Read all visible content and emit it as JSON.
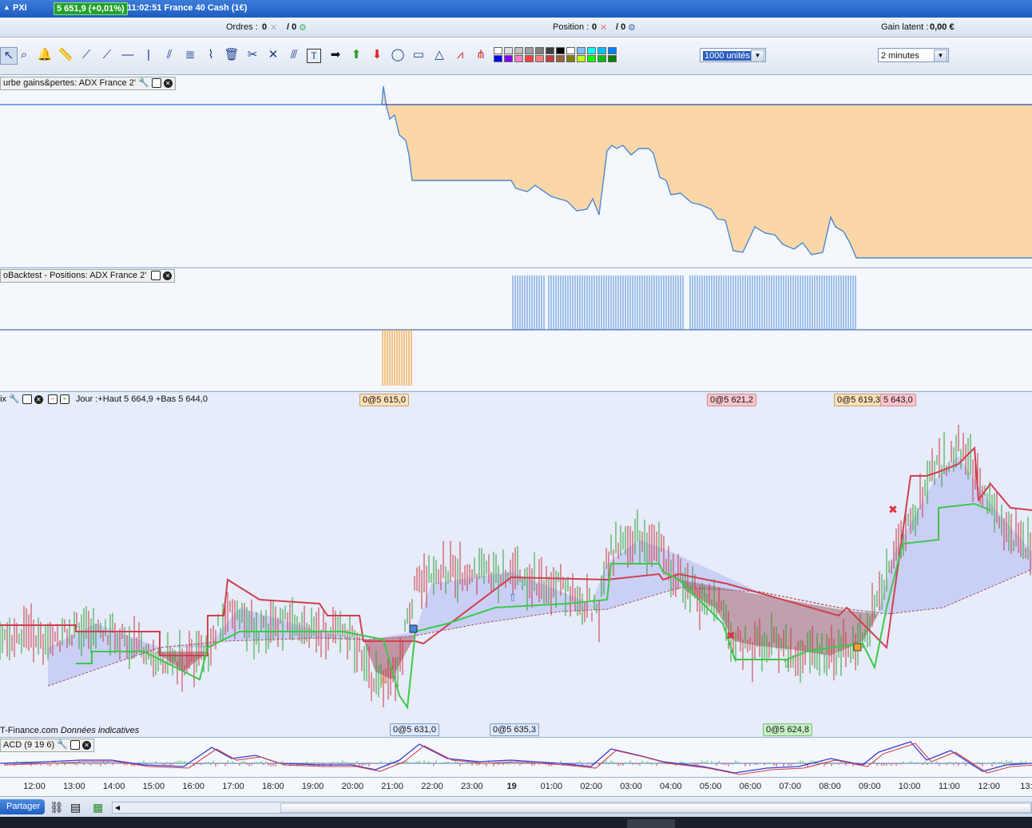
{
  "topbar": {
    "symbol": "PXI",
    "price_change": "5 651,9 (+0,01%)",
    "time_instrument": "11:02:51 France 40 Cash (1€)"
  },
  "orderbar": {
    "orders_label": "Ordres :",
    "orders_val1": "0",
    "orders_val2": "/ 0",
    "position_label": "Position :",
    "position_val1": "0",
    "position_val2": "/ 0",
    "gain_label": "Gain latent :",
    "gain_value": "0,00 €"
  },
  "toolbar": {
    "size_select": "1000 unités",
    "timeframe_select": "2 minutes"
  },
  "panels": {
    "equity_title": "urbe gains&pertes: ADX France 2'",
    "positions_title": "oBacktest - Positions: ADX France 2'",
    "price_title": "ix",
    "price_info": "Jour :+Haut 5 664,9 +Bas 5 644,0",
    "source": "T-Finance.com",
    "source_note": "Données indicatives",
    "macd_title": "ACD (9 19 6)"
  },
  "flags": {
    "f1": "0@5 615,0",
    "f2": "0@5 621,2",
    "f3": "0@5 619,3",
    "f4": "5 643,0",
    "f5": "0@5 631,0",
    "f6": "0@5 635,3",
    "f7": "0@5 624,8"
  },
  "time_axis": [
    "12:00",
    "13:00",
    "14:00",
    "15:00",
    "16:00",
    "17:00",
    "18:00",
    "19:00",
    "20:00",
    "21:00",
    "22:00",
    "23:00",
    "19",
    "01:00",
    "02:00",
    "03:00",
    "04:00",
    "05:00",
    "06:00",
    "07:00",
    "08:00",
    "09:00",
    "10:00",
    "11:00",
    "12:00",
    "13:0"
  ],
  "bottombar": {
    "share_button": "Partager"
  },
  "colors": {
    "accent": "#1d5cc2",
    "bull": "#2e9e2e",
    "bear": "#c8343c",
    "equity_fill": "#fbd7a8",
    "long": "#4a88d8",
    "short": "#f0a030"
  }
}
